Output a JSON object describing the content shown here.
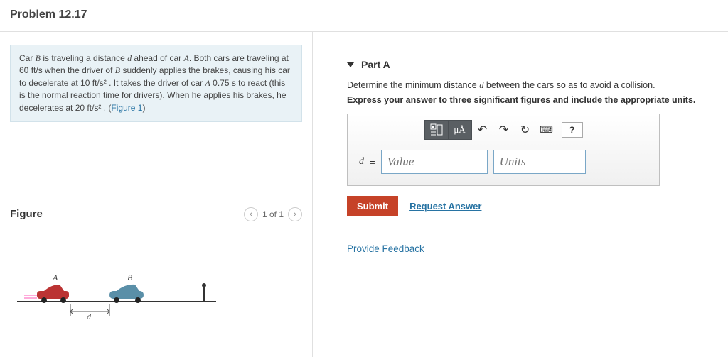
{
  "title": "Problem 12.17",
  "intro": {
    "pre1": "Car ",
    "carB": "B",
    "mid1": " is traveling a distance ",
    "d1": "d",
    "mid2": " ahead of car ",
    "carA1": "A",
    "mid3": ". Both cars are traveling at 60 ",
    "u1": "ft/s",
    "mid4": " when the driver of ",
    "carB2": "B",
    "mid5": " suddenly applies the brakes, causing his car to decelerate at 10 ",
    "u2": "ft/s²",
    "mid6": " . It takes the driver of car ",
    "carA2": "A",
    "mid7": " 0.75 s to react (this is the normal reaction time for drivers). When he applies his brakes, he decelerates at 20 ",
    "u3": "ft/s²",
    "mid8": " . (",
    "figref": "Figure 1",
    "mid9": ")"
  },
  "figure": {
    "heading": "Figure",
    "pager": "1 of 1",
    "labelA": "A",
    "labelB": "B",
    "dlabel": "d"
  },
  "part": {
    "label": "Part A",
    "prompt_pre": "Determine the minimum distance ",
    "prompt_var": "d",
    "prompt_post": " between the cars so as to avoid a collision.",
    "instruction": "Express your answer to three significant figures and include the appropriate units.",
    "mu_label": "μÅ",
    "help": "?",
    "var": "d",
    "eq": "=",
    "value_ph": "Value",
    "units_ph": "Units",
    "submit": "Submit",
    "request": "Request Answer"
  },
  "feedback": "Provide Feedback"
}
